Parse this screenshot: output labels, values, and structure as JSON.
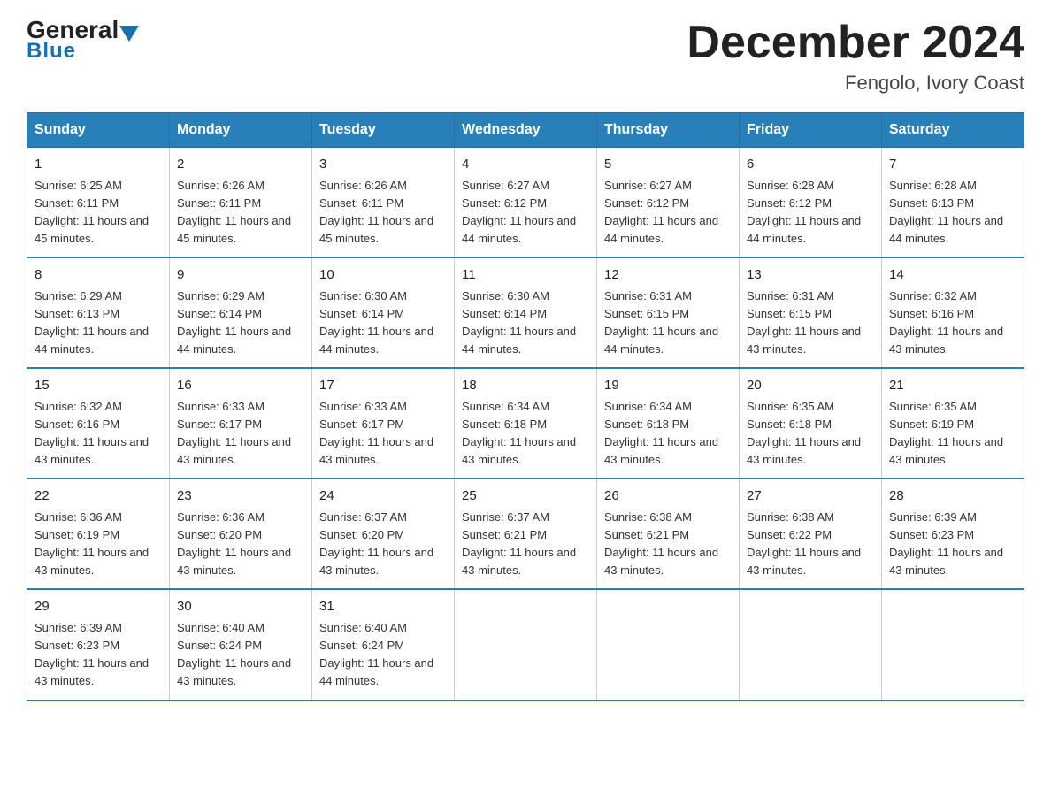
{
  "logo": {
    "brand": "General",
    "brand2": "Blue"
  },
  "header": {
    "title": "December 2024",
    "subtitle": "Fengolo, Ivory Coast"
  },
  "columns": [
    "Sunday",
    "Monday",
    "Tuesday",
    "Wednesday",
    "Thursday",
    "Friday",
    "Saturday"
  ],
  "weeks": [
    [
      {
        "day": "1",
        "sunrise": "6:25 AM",
        "sunset": "6:11 PM",
        "daylight": "11 hours and 45 minutes."
      },
      {
        "day": "2",
        "sunrise": "6:26 AM",
        "sunset": "6:11 PM",
        "daylight": "11 hours and 45 minutes."
      },
      {
        "day": "3",
        "sunrise": "6:26 AM",
        "sunset": "6:11 PM",
        "daylight": "11 hours and 45 minutes."
      },
      {
        "day": "4",
        "sunrise": "6:27 AM",
        "sunset": "6:12 PM",
        "daylight": "11 hours and 44 minutes."
      },
      {
        "day": "5",
        "sunrise": "6:27 AM",
        "sunset": "6:12 PM",
        "daylight": "11 hours and 44 minutes."
      },
      {
        "day": "6",
        "sunrise": "6:28 AM",
        "sunset": "6:12 PM",
        "daylight": "11 hours and 44 minutes."
      },
      {
        "day": "7",
        "sunrise": "6:28 AM",
        "sunset": "6:13 PM",
        "daylight": "11 hours and 44 minutes."
      }
    ],
    [
      {
        "day": "8",
        "sunrise": "6:29 AM",
        "sunset": "6:13 PM",
        "daylight": "11 hours and 44 minutes."
      },
      {
        "day": "9",
        "sunrise": "6:29 AM",
        "sunset": "6:14 PM",
        "daylight": "11 hours and 44 minutes."
      },
      {
        "day": "10",
        "sunrise": "6:30 AM",
        "sunset": "6:14 PM",
        "daylight": "11 hours and 44 minutes."
      },
      {
        "day": "11",
        "sunrise": "6:30 AM",
        "sunset": "6:14 PM",
        "daylight": "11 hours and 44 minutes."
      },
      {
        "day": "12",
        "sunrise": "6:31 AM",
        "sunset": "6:15 PM",
        "daylight": "11 hours and 44 minutes."
      },
      {
        "day": "13",
        "sunrise": "6:31 AM",
        "sunset": "6:15 PM",
        "daylight": "11 hours and 43 minutes."
      },
      {
        "day": "14",
        "sunrise": "6:32 AM",
        "sunset": "6:16 PM",
        "daylight": "11 hours and 43 minutes."
      }
    ],
    [
      {
        "day": "15",
        "sunrise": "6:32 AM",
        "sunset": "6:16 PM",
        "daylight": "11 hours and 43 minutes."
      },
      {
        "day": "16",
        "sunrise": "6:33 AM",
        "sunset": "6:17 PM",
        "daylight": "11 hours and 43 minutes."
      },
      {
        "day": "17",
        "sunrise": "6:33 AM",
        "sunset": "6:17 PM",
        "daylight": "11 hours and 43 minutes."
      },
      {
        "day": "18",
        "sunrise": "6:34 AM",
        "sunset": "6:18 PM",
        "daylight": "11 hours and 43 minutes."
      },
      {
        "day": "19",
        "sunrise": "6:34 AM",
        "sunset": "6:18 PM",
        "daylight": "11 hours and 43 minutes."
      },
      {
        "day": "20",
        "sunrise": "6:35 AM",
        "sunset": "6:18 PM",
        "daylight": "11 hours and 43 minutes."
      },
      {
        "day": "21",
        "sunrise": "6:35 AM",
        "sunset": "6:19 PM",
        "daylight": "11 hours and 43 minutes."
      }
    ],
    [
      {
        "day": "22",
        "sunrise": "6:36 AM",
        "sunset": "6:19 PM",
        "daylight": "11 hours and 43 minutes."
      },
      {
        "day": "23",
        "sunrise": "6:36 AM",
        "sunset": "6:20 PM",
        "daylight": "11 hours and 43 minutes."
      },
      {
        "day": "24",
        "sunrise": "6:37 AM",
        "sunset": "6:20 PM",
        "daylight": "11 hours and 43 minutes."
      },
      {
        "day": "25",
        "sunrise": "6:37 AM",
        "sunset": "6:21 PM",
        "daylight": "11 hours and 43 minutes."
      },
      {
        "day": "26",
        "sunrise": "6:38 AM",
        "sunset": "6:21 PM",
        "daylight": "11 hours and 43 minutes."
      },
      {
        "day": "27",
        "sunrise": "6:38 AM",
        "sunset": "6:22 PM",
        "daylight": "11 hours and 43 minutes."
      },
      {
        "day": "28",
        "sunrise": "6:39 AM",
        "sunset": "6:23 PM",
        "daylight": "11 hours and 43 minutes."
      }
    ],
    [
      {
        "day": "29",
        "sunrise": "6:39 AM",
        "sunset": "6:23 PM",
        "daylight": "11 hours and 43 minutes."
      },
      {
        "day": "30",
        "sunrise": "6:40 AM",
        "sunset": "6:24 PM",
        "daylight": "11 hours and 43 minutes."
      },
      {
        "day": "31",
        "sunrise": "6:40 AM",
        "sunset": "6:24 PM",
        "daylight": "11 hours and 44 minutes."
      },
      {
        "day": "",
        "sunrise": "",
        "sunset": "",
        "daylight": ""
      },
      {
        "day": "",
        "sunrise": "",
        "sunset": "",
        "daylight": ""
      },
      {
        "day": "",
        "sunrise": "",
        "sunset": "",
        "daylight": ""
      },
      {
        "day": "",
        "sunrise": "",
        "sunset": "",
        "daylight": ""
      }
    ]
  ]
}
